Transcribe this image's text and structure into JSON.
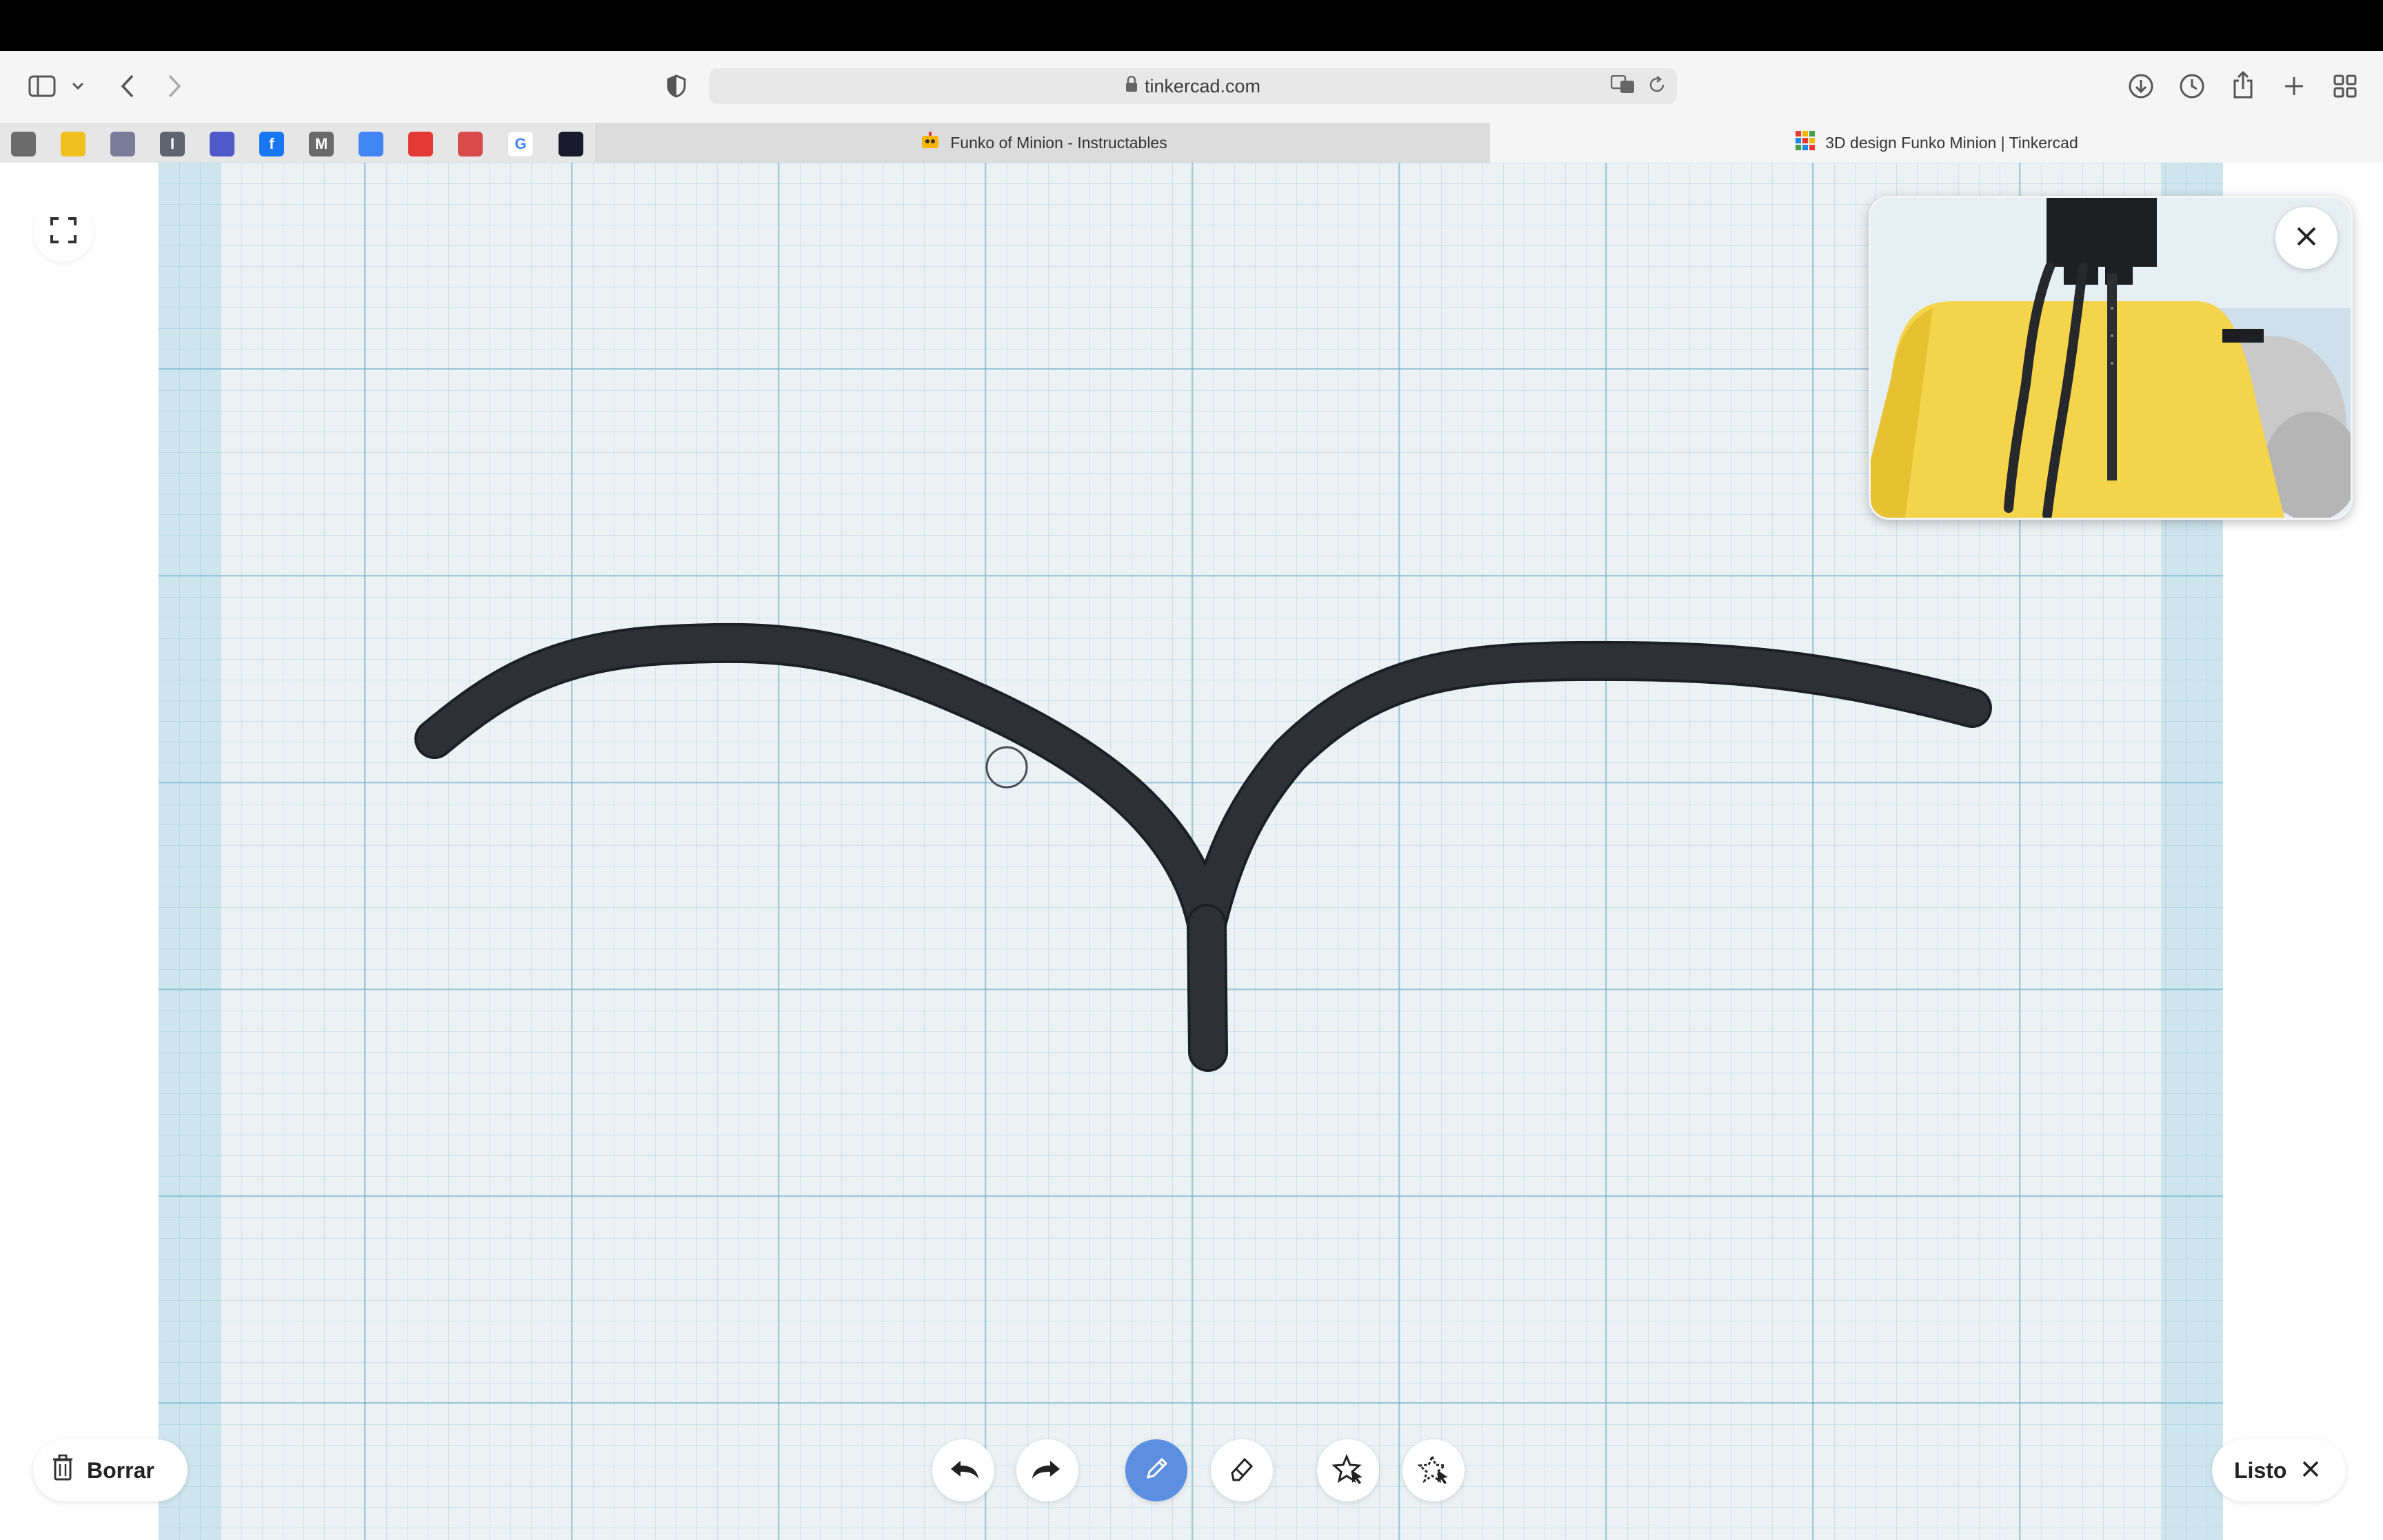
{
  "browser": {
    "url": "tinkercad.com",
    "tabs": [
      {
        "label": "Funko of Minion - Instructables",
        "active": false
      },
      {
        "label": "3D design Funko Minion | Tinkercad",
        "active": true
      }
    ],
    "favorites": [
      {
        "icon": "favorite-app-icon-1",
        "color": "#6b6b6b"
      },
      {
        "icon": "favorite-app-icon-2",
        "color": "#f0c020"
      },
      {
        "icon": "favorite-app-icon-3",
        "color": "#7b7b9a"
      },
      {
        "icon": "instapaper-icon",
        "color": "#606470"
      },
      {
        "icon": "teams-icon",
        "color": "#5059c9"
      },
      {
        "icon": "facebook-icon",
        "color": "#1877f2"
      },
      {
        "icon": "medium-icon",
        "color": "#6a6a6a"
      },
      {
        "icon": "docs-icon",
        "color": "#4285f4"
      },
      {
        "icon": "tinkercad-icon",
        "color": "#e53935"
      },
      {
        "icon": "book-icon",
        "color": "#d94b4b"
      },
      {
        "icon": "google-icon",
        "color": "#ffffff"
      },
      {
        "icon": "codepen-icon",
        "color": "#1a1a2e"
      }
    ],
    "favorite_letters": [
      "",
      "",
      "",
      "I",
      "",
      "f",
      "M",
      "",
      "",
      "",
      "G",
      ""
    ]
  },
  "editor": {
    "fullscreen_icon": "fullscreen-icon",
    "stroke_color": "#2b2d31",
    "preview": {
      "close_icon": "close-icon"
    }
  },
  "toolbar": {
    "delete_label": "Borrar",
    "done_label": "Listo",
    "tools": [
      {
        "name": "undo-button",
        "icon": "undo-icon",
        "active": false
      },
      {
        "name": "redo-button",
        "icon": "redo-icon",
        "active": false
      },
      {
        "name": "pencil-button",
        "icon": "pencil-icon",
        "active": true
      },
      {
        "name": "eraser-button",
        "icon": "eraser-icon",
        "active": false
      },
      {
        "name": "shape-select-button",
        "icon": "select-shape-icon",
        "active": false
      },
      {
        "name": "shape-deselect-button",
        "icon": "deselect-shape-icon",
        "active": false
      }
    ],
    "accent": "#5d8fe0"
  }
}
